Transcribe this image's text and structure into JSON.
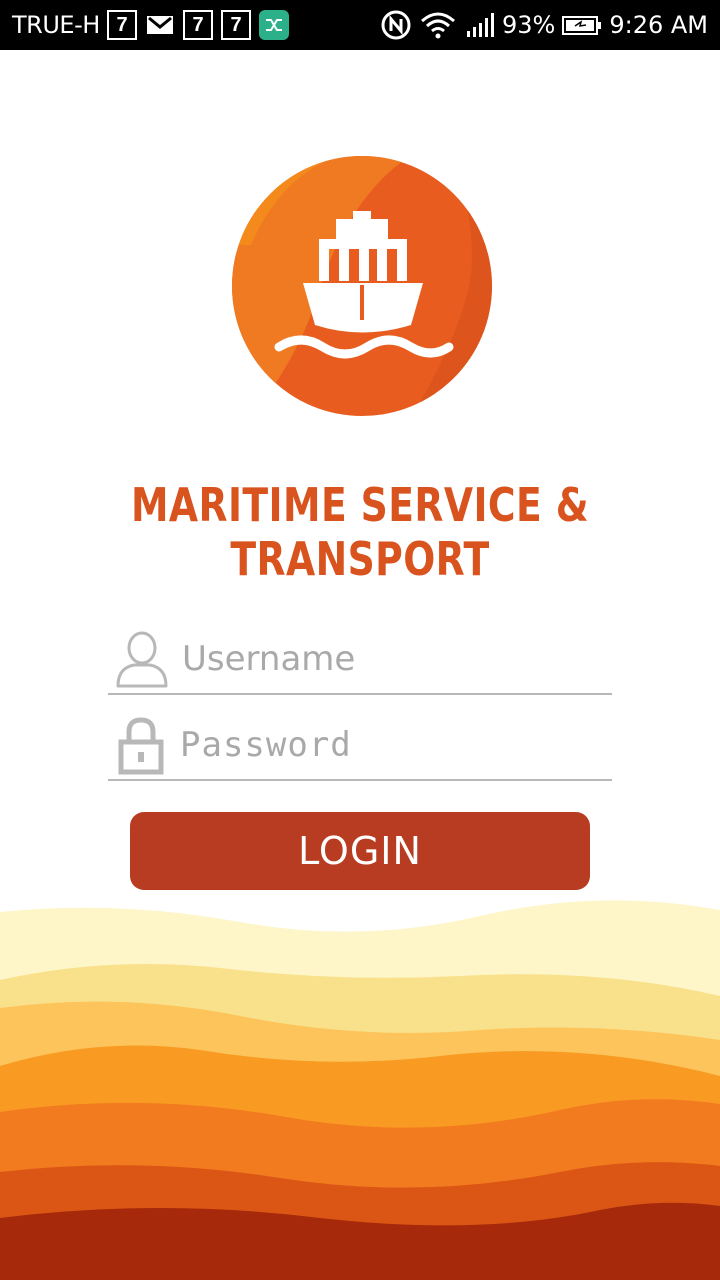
{
  "status_bar": {
    "carrier": "TRUE-H",
    "battery": "93%",
    "time": "9:26 AM",
    "icons": [
      "seven-eleven-icon",
      "gmail-icon",
      "seven-eleven-icon",
      "seven-eleven-icon",
      "shuffle-app-icon",
      "nfc-icon",
      "wifi-icon",
      "signal-icon",
      "battery-icon"
    ]
  },
  "brand": {
    "title": "MARITIME SERVICE & TRANSPORT",
    "logo_icon": "ship-icon",
    "accent_color": "#e85d1f",
    "title_color": "#d9531e"
  },
  "form": {
    "username": {
      "placeholder": "Username",
      "value": "",
      "icon": "user-icon"
    },
    "password": {
      "placeholder": "Password",
      "value": "",
      "icon": "lock-icon"
    },
    "login_label": "LOGIN",
    "login_color": "#b83c22"
  }
}
